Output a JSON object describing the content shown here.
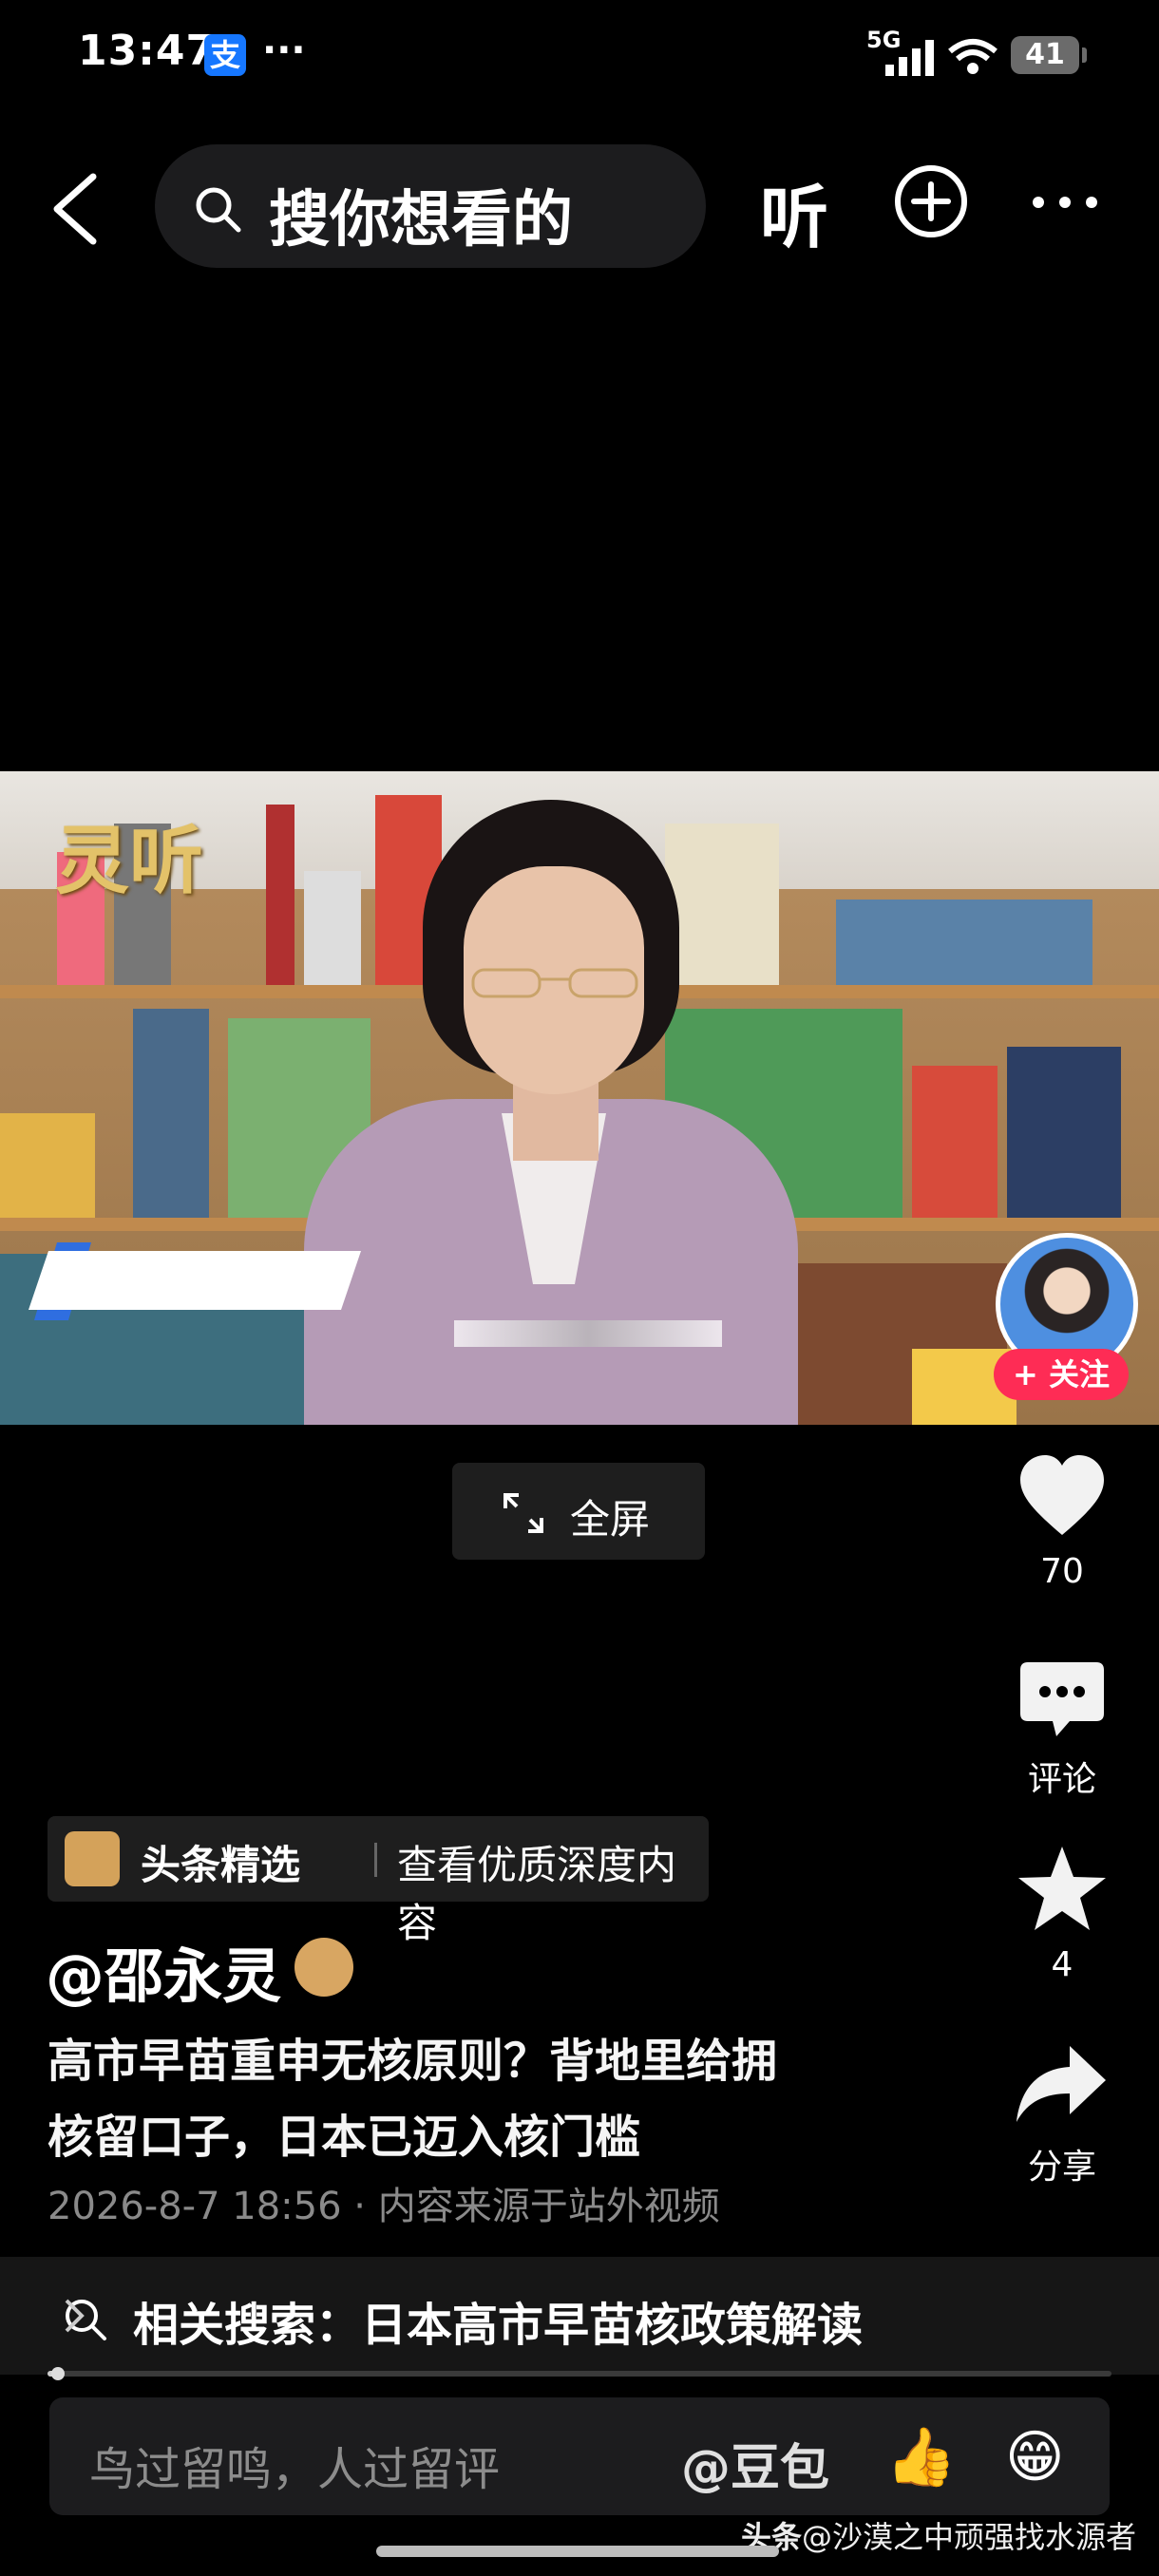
{
  "status_bar": {
    "time": "13:47",
    "app_badge": "支",
    "dots": "···",
    "network": "5G",
    "battery": "41"
  },
  "nav": {
    "search_placeholder": "搜你想看的",
    "listen_label": "听"
  },
  "video": {
    "channel_logo": "灵听",
    "fullscreen_label": "全屏"
  },
  "follow": {
    "label": "+ 关注"
  },
  "actions": {
    "likes": "70",
    "comment_label": "评论",
    "favorites": "4",
    "share_label": "分享"
  },
  "badge": {
    "title": "头条精选",
    "subtitle": "查看优质深度内容"
  },
  "post": {
    "author": "@邵永灵",
    "title_line1": "高市早苗重申无核原则？背地里给拥",
    "title_line2": "核留口子，日本已迈入核门槛",
    "meta": "2026-8-7 18:56 · 内容来源于站外视频"
  },
  "related": {
    "text": "相关搜索：日本高市早苗核政策解读"
  },
  "playback": {
    "progress_fraction": 0.01
  },
  "comment": {
    "placeholder": "鸟过留鸣，人过留评",
    "doubao": "@豆包",
    "emoji_thumb": "👍",
    "emoji_grin": "😁"
  },
  "watermark": {
    "brand": "头条",
    "handle": "@沙漠之中顽强找水源者"
  },
  "colors": {
    "accent_red": "#fe2c55",
    "verified_gold": "#d8a662",
    "alipay_blue": "#1677ff"
  }
}
